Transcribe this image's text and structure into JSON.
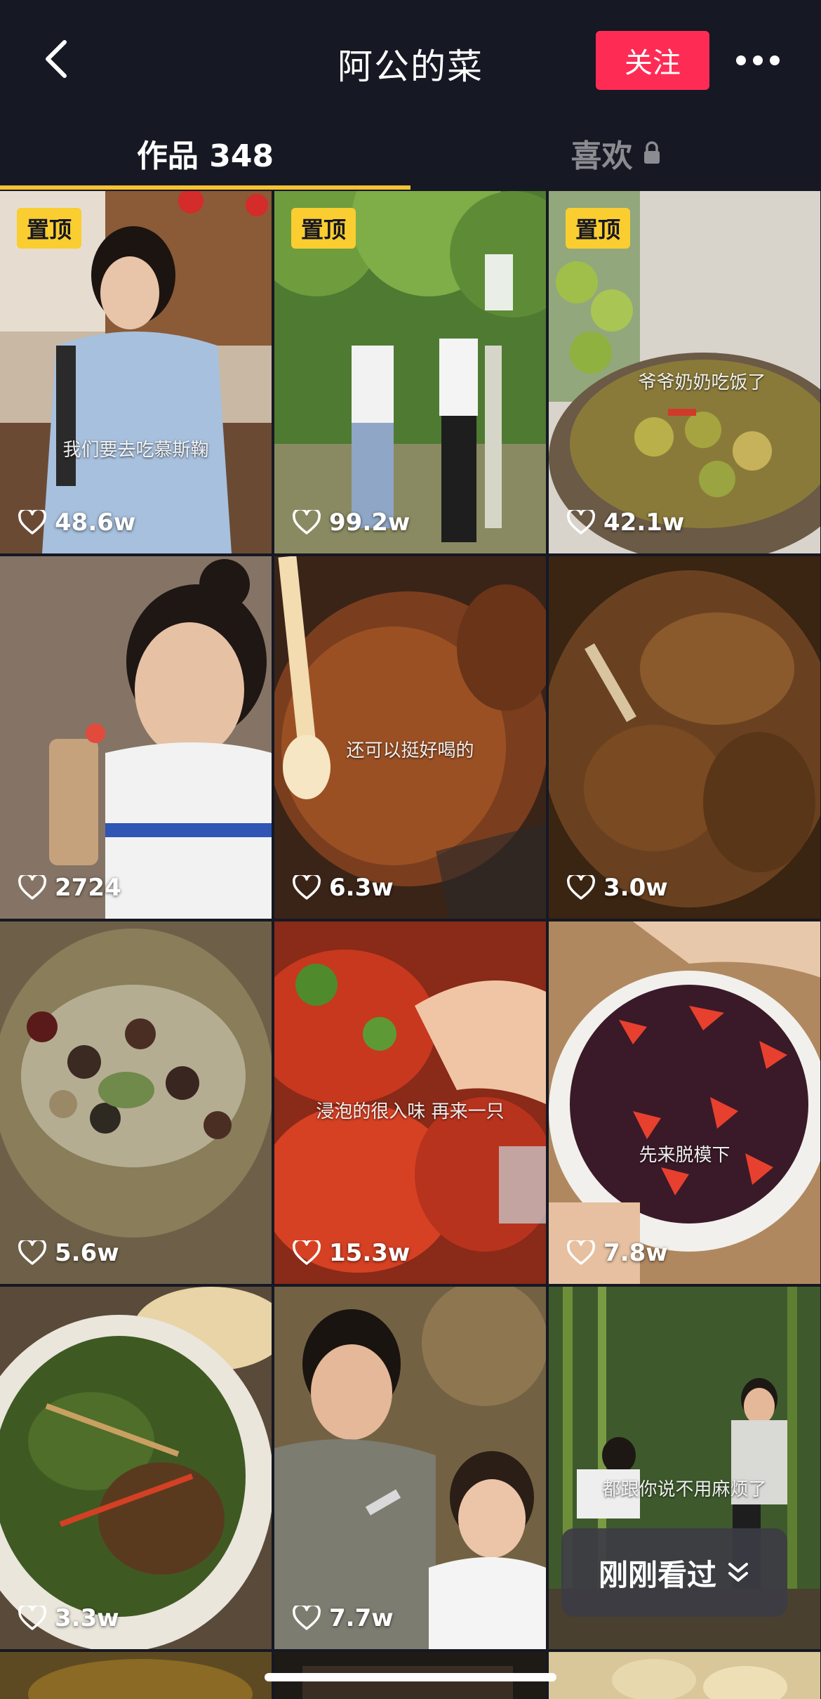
{
  "header": {
    "title": "阿公的菜",
    "follow_label": "关注",
    "back_icon": "chevron-left-icon",
    "more_icon": "ellipsis-icon"
  },
  "tabs": {
    "works_label": "作品 348",
    "likes_label": "喜欢",
    "likes_icon": "lock-icon",
    "active_color": "#f6c234"
  },
  "grid": {
    "items": [
      {
        "pinned": "置顶",
        "caption": "我们要去吃慕斯鞠",
        "likes": "48.6w"
      },
      {
        "pinned": "置顶",
        "caption": "",
        "likes": "99.2w"
      },
      {
        "pinned": "置顶",
        "caption": "爷爷奶奶吃饭了",
        "likes": "42.1w"
      },
      {
        "pinned": "",
        "caption": "",
        "likes": "2724"
      },
      {
        "pinned": "",
        "caption": "还可以挺好喝的",
        "likes": "6.3w"
      },
      {
        "pinned": "",
        "caption": "",
        "likes": "3.0w"
      },
      {
        "pinned": "",
        "caption": "",
        "likes": "5.6w"
      },
      {
        "pinned": "",
        "caption": "浸泡的很入味 再来一只",
        "likes": "15.3w"
      },
      {
        "pinned": "",
        "caption": "先来脱模下",
        "likes": "7.8w"
      },
      {
        "pinned": "",
        "caption": "",
        "likes": "3.3w"
      },
      {
        "pinned": "",
        "caption": "",
        "likes": "7.7w"
      },
      {
        "pinned": "",
        "caption": "都跟你说不用麻烦了",
        "likes": ""
      }
    ]
  },
  "recent": {
    "label": "刚刚看过",
    "icon": "double-chevron-down-icon"
  },
  "colors": {
    "background": "#161823",
    "follow": "#fe2c55",
    "pin": "#facd30"
  }
}
